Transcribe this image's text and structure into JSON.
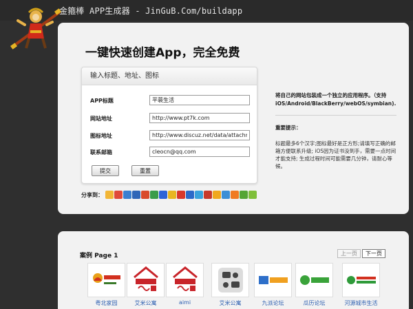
{
  "header": {
    "title": "金箍棒 APP生成器 - JinGuB.Com/buildapp"
  },
  "main": {
    "headline": "一键快速创建App，完全免费",
    "form": {
      "section_title": "输入标题、地址、图标",
      "fields": [
        {
          "label": "APP标题",
          "value": "平蓑生活"
        },
        {
          "label": "网站地址",
          "value": "http://www.pt7k.com"
        },
        {
          "label": "图标地址",
          "value": "http://www.discuz.net/data/attachme"
        },
        {
          "label": "联系邮箱",
          "value": "cleocn@qq.com"
        }
      ],
      "submit_label": "提交",
      "reset_label": "重置"
    },
    "share": {
      "label": "分享到：",
      "icons": [
        {
          "name": "qzone-icon",
          "color": "#f2b636"
        },
        {
          "name": "sina-weibo-icon",
          "color": "#e04a3a"
        },
        {
          "name": "tencent-weibo-icon",
          "color": "#3a7fd0"
        },
        {
          "name": "renren-icon",
          "color": "#2f66b8"
        },
        {
          "name": "kaixin-icon",
          "color": "#d94b2b"
        },
        {
          "name": "douban-icon",
          "color": "#3a9d4a"
        },
        {
          "name": "baidu-icon",
          "color": "#2e64d8"
        },
        {
          "name": "mail-icon",
          "color": "#e8b622"
        },
        {
          "name": "sohu-icon",
          "color": "#d8382b"
        },
        {
          "name": "163-icon",
          "color": "#2c6ac9"
        },
        {
          "name": "msn-icon",
          "color": "#3aa3dc"
        },
        {
          "name": "netease-icon",
          "color": "#c73a2b"
        },
        {
          "name": "star-icon",
          "color": "#f0a81e"
        },
        {
          "name": "bookmark-icon",
          "color": "#3c8fd6"
        },
        {
          "name": "taobao-icon",
          "color": "#f07b22"
        },
        {
          "name": "weixin-icon",
          "color": "#55a534"
        },
        {
          "name": "more-icon",
          "color": "#7fbf3a"
        }
      ]
    },
    "info": {
      "description": "将自己的网站包装成一个独立的应用程序。（支持iOS/Android/BlackBerry/webOS/symbian).",
      "tips_title": "重要提示：",
      "tips_text": "标题最多6个汉字;图标最好是正方形;请填写正确的邮箱方便联系升级; iOS因为证书没到手，需要一点时间才能支持; 生成过程时间可能需要几分钟，请耐心等候。"
    }
  },
  "cases": {
    "title": "案例 Page 1",
    "prev_label": "上一页",
    "next_label": "下一页",
    "items": [
      {
        "label": "粤北家园",
        "icon": "yuebei-logo-icon"
      },
      {
        "label": "艾米公寓",
        "icon": "aimi-apartment-logo-icon"
      },
      {
        "label": "aimi",
        "icon": "aimi-logo-icon"
      },
      {
        "label": "艾米公寓",
        "icon": "chat-app-icon"
      },
      {
        "label": "九派论坛",
        "icon": "jiupai-logo-icon"
      },
      {
        "label": "瓜历论坛",
        "icon": "guali-logo-icon"
      },
      {
        "label": "河源城市生活",
        "icon": "heyuan-logo-icon"
      }
    ]
  }
}
